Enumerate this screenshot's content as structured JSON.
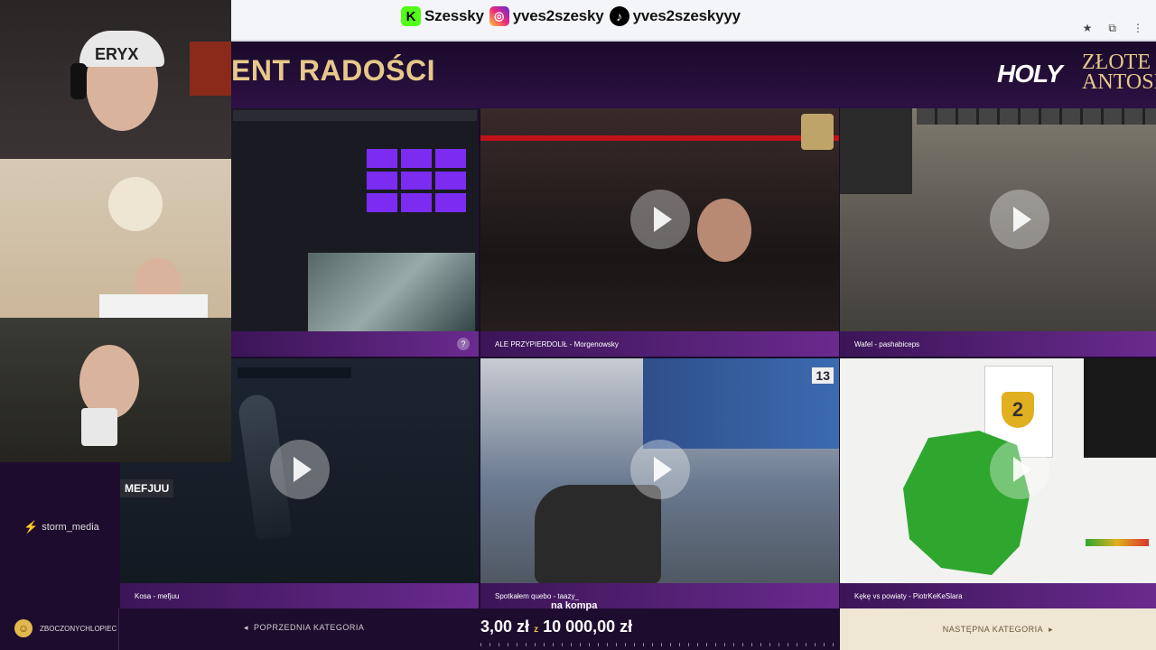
{
  "social": {
    "kick_name": "Szessky",
    "instagram_name": "yves2szesky",
    "tiktok_name": "yves2szeskyyy"
  },
  "banner": {
    "title": "ENT RADOŚCI",
    "logo_word": "HOLY",
    "logo_sub_line1": "ZŁOTE",
    "logo_sub_line2": "ANTOSI"
  },
  "tiles": [
    {
      "caption": ""
    },
    {
      "caption": "ALE PRZYPIERDOLIŁ - Morgenowsky"
    },
    {
      "caption": "Wafel - pashabiceps"
    },
    {
      "caption": "Kosa - mefjuu"
    },
    {
      "caption": "Spotkałem quebo - taazy_"
    },
    {
      "caption": "Kękę vs powiaty - PiotrKeKeSlara"
    }
  ],
  "cams": {
    "cam1_label": "ERYX",
    "cam3_name": "MEFJUU"
  },
  "storm": {
    "brand": "storm_media"
  },
  "bottom": {
    "username": "ZBOCZONYCHLOPIEC",
    "prev_category": "POPRZEDNIA KATEGORIA",
    "next_category": "NASTĘPNA KATEGORIA",
    "na_kompa": "na kompa",
    "price_low": "3,00 zł",
    "price_high": "10 000,00 zł"
  },
  "colors": {
    "accent_purple": "#6a2a8e",
    "gold": "#e6c98a",
    "kick_green": "#53fc18"
  }
}
